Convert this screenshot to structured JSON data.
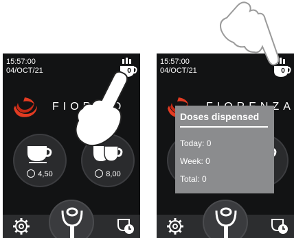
{
  "left_screen": {
    "time": "15:57:00",
    "date": "04/OCT/21",
    "counter_value": "0",
    "brand": "FIOR  TO",
    "single_dose_time": "4,50",
    "double_dose_time": "8,00"
  },
  "right_screen": {
    "time": "15:57:00",
    "date": "04/OCT/21",
    "counter_value": "0",
    "brand": "FIORENZATO",
    "popup": {
      "title": "Doses dispensed",
      "today": "Today:  0",
      "week": "Week: 0",
      "total": "Total: 0"
    }
  },
  "colors": {
    "screen_bg": "#121314",
    "button_bg": "#2a2b2d",
    "bar_bg": "#2c2d2f",
    "popup_bg": "#8b8c8e",
    "logo_red": "#e23b22"
  },
  "icons": [
    "cup-counter-icon",
    "fiorenzato-logo-icon",
    "single-cup-icon",
    "double-cup-icon",
    "clock-icon",
    "gear-icon",
    "portafilter-icon",
    "cup-clock-icon",
    "pointing-hand-icon"
  ]
}
